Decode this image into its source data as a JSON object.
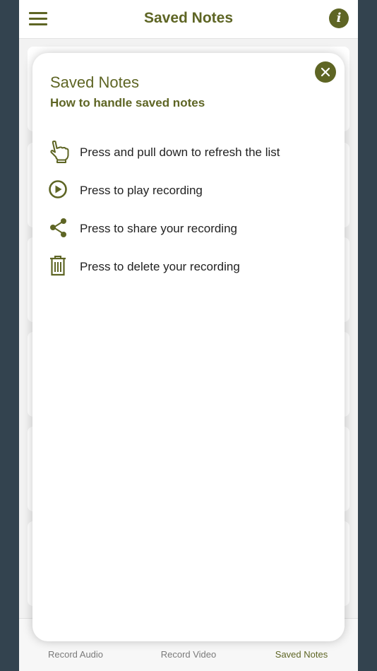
{
  "header": {
    "title": "Saved Notes",
    "menu_icon": "hamburger-menu-icon",
    "info_icon": "info-icon"
  },
  "colors": {
    "accent": "#5e6524",
    "background_outer": "#33434f",
    "app_background": "#f2f2f2",
    "card": "#ffffff",
    "text": "#222222",
    "tab_inactive": "#7a7a7a"
  },
  "tabs": [
    {
      "label": "Record Audio",
      "active": false
    },
    {
      "label": "Record Video",
      "active": false
    },
    {
      "label": "Saved Notes",
      "active": true
    }
  ],
  "modal": {
    "title": "Saved Notes",
    "subtitle": "How to handle saved notes",
    "close_icon": "close-icon",
    "items": [
      {
        "icon": "hand-pull-icon",
        "text": "Press and pull down to refresh the list"
      },
      {
        "icon": "play-icon",
        "text": "Press to play recording"
      },
      {
        "icon": "share-icon",
        "text": "Press to share your recording"
      },
      {
        "icon": "trash-icon",
        "text": "Press to delete your recording"
      }
    ]
  }
}
